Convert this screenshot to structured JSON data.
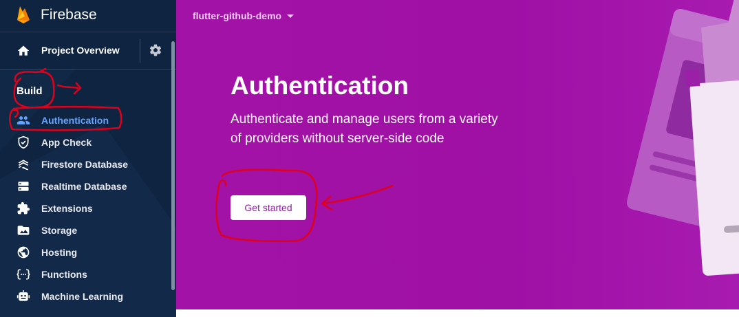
{
  "brand": {
    "name": "Firebase"
  },
  "sidebar": {
    "overview_label": "Project Overview",
    "section_label": "Build",
    "items": [
      {
        "label": "Authentication",
        "icon": "people-icon",
        "active": true
      },
      {
        "label": "App Check",
        "icon": "shield-icon"
      },
      {
        "label": "Firestore Database",
        "icon": "firestore-icon"
      },
      {
        "label": "Realtime Database",
        "icon": "database-icon"
      },
      {
        "label": "Extensions",
        "icon": "puzzle-icon"
      },
      {
        "label": "Storage",
        "icon": "folder-icon"
      },
      {
        "label": "Hosting",
        "icon": "globe-icon"
      },
      {
        "label": "Functions",
        "icon": "functions-icon"
      },
      {
        "label": "Machine Learning",
        "icon": "robot-icon"
      }
    ]
  },
  "header": {
    "project_name": "flutter-github-demo"
  },
  "hero": {
    "title": "Authentication",
    "description": "Authenticate and manage users from a variety of providers without server-side code",
    "cta_label": "Get started"
  },
  "colors": {
    "sidebar_bg": "#0f2440",
    "active_text": "#66a3ff",
    "hero_bg": "#a312a6",
    "annotation": "#e0001a"
  }
}
